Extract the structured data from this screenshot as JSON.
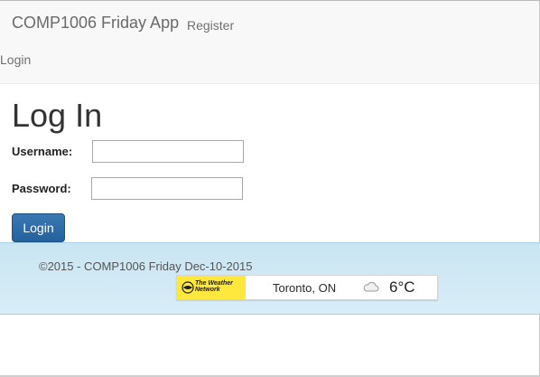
{
  "navbar": {
    "brand": "COMP1006 Friday App",
    "links": [
      {
        "label": "Register"
      },
      {
        "label": "Login"
      }
    ]
  },
  "main": {
    "title": "Log In",
    "username_label": "Username",
    "password_label": "Password",
    "username_value": "",
    "password_value": "",
    "login_button": "Login"
  },
  "footer": {
    "copyright": "©2015 - COMP1006 Friday Dec-10-2015",
    "weather": {
      "logo_line1": "The Weather",
      "logo_line2": "Network",
      "city": "Toronto, ON",
      "temperature": "6°C",
      "icon": "cloud-icon"
    }
  },
  "colors": {
    "navbar_bg": "#f8f8f8",
    "primary_button": "#2d6ca9",
    "footer_bg": "#d0e8f4",
    "weather_logo_bg": "#ffe83b"
  }
}
